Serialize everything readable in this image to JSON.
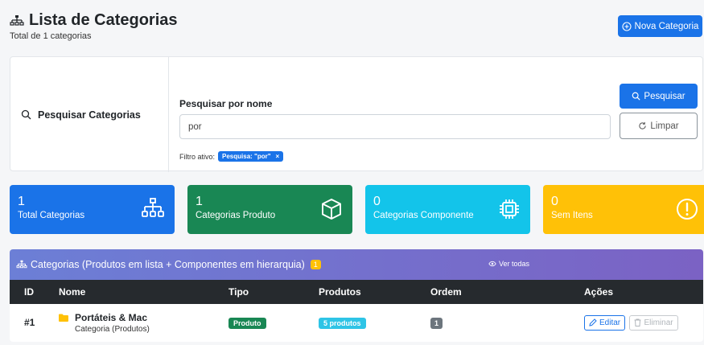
{
  "header": {
    "title": "Lista de Categorias",
    "subtitle": "Total de 1 categorias",
    "new_button_label": "Nova Categoria"
  },
  "search": {
    "section_title": "Pesquisar Categorias",
    "field_label": "Pesquisar por nome",
    "input_value": "por",
    "filter_prefix": "Filtro ativo:",
    "filter_badge": "Pesquisa: \"por\"",
    "filter_remove": "×",
    "search_button": "Pesquisar",
    "clear_button": "Limpar"
  },
  "stats": [
    {
      "value": "1",
      "label": "Total Categorias",
      "color": "#1a73e8",
      "icon": "sitemap-icon"
    },
    {
      "value": "1",
      "label": "Categorias Produto",
      "color": "#198754",
      "icon": "box-icon"
    },
    {
      "value": "0",
      "label": "Categorias Componente",
      "color": "#13c4ea",
      "icon": "cpu-icon"
    },
    {
      "value": "0",
      "label": "Sem Itens",
      "color": "#ffc107",
      "icon": "exclamation-circle-icon"
    }
  ],
  "table": {
    "title": "Categorias (Produtos em lista + Componentes em hierarquia)",
    "count": "1",
    "view_all": "Ver todas",
    "columns": [
      "ID",
      "Nome",
      "Tipo",
      "Produtos",
      "Ordem",
      "Ações"
    ],
    "rows": [
      {
        "id": "#1",
        "name": "Portáteis & Mac",
        "subtitle": "Categoria (Produtos)",
        "type": "Produto",
        "products": "5 produtos",
        "order": "1",
        "edit_label": "Editar",
        "delete_label": "Eliminar"
      }
    ]
  }
}
